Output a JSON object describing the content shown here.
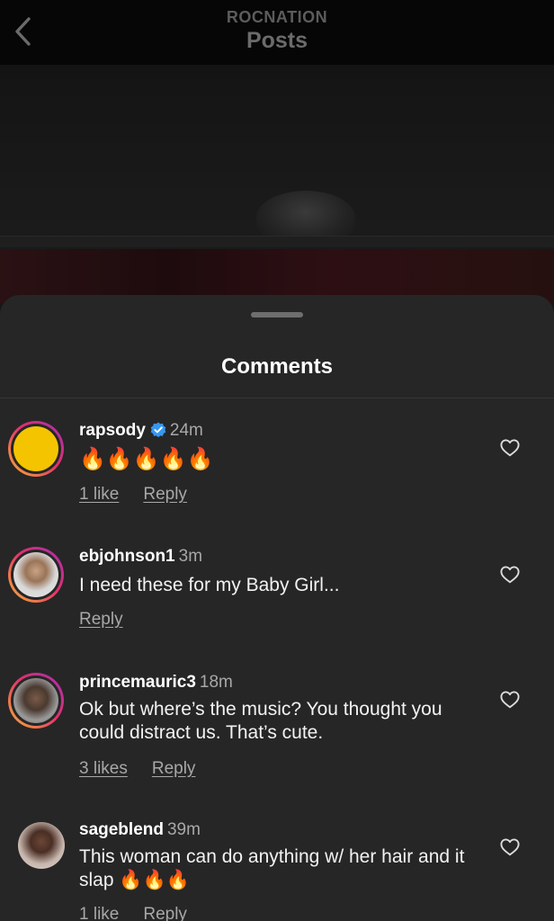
{
  "header": {
    "subtitle": "ROCNATION",
    "title": "Posts",
    "back_icon": "chevron-left-icon"
  },
  "sheet": {
    "title": "Comments"
  },
  "comments": [
    {
      "username": "rapsody",
      "verified": true,
      "time": "24m",
      "text": "🔥🔥🔥🔥🔥",
      "likes": "1 like",
      "reply": "Reply",
      "avatar_color": "#f5c400"
    },
    {
      "username": "ebjohnson1",
      "verified": false,
      "time": "3m",
      "text": "I need these for my Baby Girl...",
      "likes": "",
      "reply": "Reply"
    },
    {
      "username": "princemauric3",
      "verified": false,
      "time": "18m",
      "text": "Ok but where’s the music? You thought you could distract us. That’s cute.",
      "likes": "3 likes",
      "reply": "Reply"
    },
    {
      "username": "sageblend",
      "verified": false,
      "time": "39m",
      "text": "This woman can do anything w/ her hair and it slap 🔥🔥🔥",
      "likes": "1 like",
      "reply": "Reply"
    }
  ],
  "colors": {
    "sheet_bg": "#262626",
    "muted_text": "#a8a8a8",
    "verified_blue": "#3897f0",
    "story_ring": [
      "#f9b233",
      "#e1306c",
      "#a22fb3"
    ]
  }
}
